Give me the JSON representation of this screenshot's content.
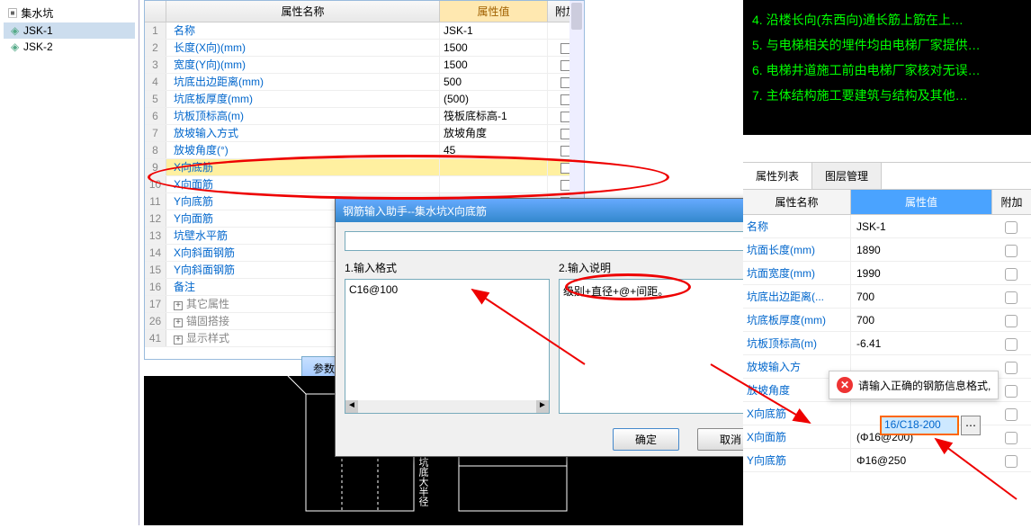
{
  "tree": {
    "root": "集水坑",
    "children": [
      "JSK-1",
      "JSK-2"
    ],
    "selected": 0
  },
  "center": {
    "head_name": "属性名称",
    "head_val": "属性值",
    "head_ext": "附加",
    "rows": [
      {
        "n": "1",
        "name": "名称",
        "val": "JSK-1",
        "link": true,
        "chk": false
      },
      {
        "n": "2",
        "name": "长度(X向)(mm)",
        "val": "1500",
        "link": true,
        "chk": true
      },
      {
        "n": "3",
        "name": "宽度(Y向)(mm)",
        "val": "1500",
        "link": true,
        "chk": true
      },
      {
        "n": "4",
        "name": "坑底出边距离(mm)",
        "val": "500",
        "link": true,
        "chk": true
      },
      {
        "n": "5",
        "name": "坑底板厚度(mm)",
        "val": "(500)",
        "link": true,
        "chk": true
      },
      {
        "n": "6",
        "name": "坑板顶标高(m)",
        "val": "筏板底标高-1",
        "link": true,
        "chk": true
      },
      {
        "n": "7",
        "name": "放坡输入方式",
        "val": "放坡角度",
        "link": true,
        "chk": true
      },
      {
        "n": "8",
        "name": "放坡角度(°)",
        "val": "45",
        "link": true,
        "chk": true
      },
      {
        "n": "9",
        "name": "X向底筋",
        "val": "",
        "link": true,
        "chk": true,
        "hl": true
      },
      {
        "n": "10",
        "name": "X向面筋",
        "val": "",
        "link": true,
        "chk": true
      },
      {
        "n": "11",
        "name": "Y向底筋",
        "val": "",
        "link": true,
        "chk": true
      },
      {
        "n": "12",
        "name": "Y向面筋",
        "val": "",
        "link": true,
        "chk": true
      },
      {
        "n": "13",
        "name": "坑壁水平筋",
        "val": "",
        "link": true,
        "chk": true
      },
      {
        "n": "14",
        "name": "X向斜面钢筋",
        "val": "",
        "link": true,
        "chk": true
      },
      {
        "n": "15",
        "name": "Y向斜面钢筋",
        "val": "",
        "link": true,
        "chk": true
      },
      {
        "n": "16",
        "name": "备注",
        "val": "",
        "link": true,
        "chk": true
      },
      {
        "n": "17",
        "name": "其它属性",
        "val": "",
        "exp": true
      },
      {
        "n": "26",
        "name": "锚固搭接",
        "val": "",
        "exp": true
      },
      {
        "n": "41",
        "name": "显示样式",
        "val": "",
        "exp": true
      }
    ]
  },
  "param_tab": "参数图",
  "dialog": {
    "title": "钢筋输入助手--集水坑X向底筋",
    "col1_label": "1.输入格式",
    "col1_item": "C16@100",
    "col2_label": "2.输入说明",
    "col2_item": "级别+直径+@+间距。",
    "ok": "确定",
    "cancel": "取消"
  },
  "notes": [
    "4. 沿楼长向(东西向)通长筋上筋在上…",
    "5. 与电梯相关的埋件均由电梯厂家提供…",
    "6. 电梯井道施工前由电梯厂家核对无误…",
    "7. 主体结构施工要建筑与结构及其他…"
  ],
  "right": {
    "tab1": "属性列表",
    "tab2": "图层管理",
    "head_name": "属性名称",
    "head_val": "属性值",
    "head_ext": "附加",
    "rows": [
      {
        "name": "名称",
        "val": "JSK-1"
      },
      {
        "name": "坑面长度(mm)",
        "val": "1890"
      },
      {
        "name": "坑面宽度(mm)",
        "val": "1990"
      },
      {
        "name": "坑底出边距离(...",
        "val": "700"
      },
      {
        "name": "坑底板厚度(mm)",
        "val": "700"
      },
      {
        "name": "坑板顶标高(m)",
        "val": "-6.41"
      },
      {
        "name": "放坡输入方",
        "val": ""
      },
      {
        "name": "放坡角度",
        "val": ""
      },
      {
        "name": "X向底筋",
        "val": ""
      },
      {
        "name": "X向面筋",
        "val": "(Φ16@200)"
      },
      {
        "name": "Y向底筋",
        "val": "Φ16@250"
      }
    ]
  },
  "error_tip": "请输入正确的钢筋信息格式,",
  "edit_value": "16/C18-200",
  "edit_dots": "⋯"
}
